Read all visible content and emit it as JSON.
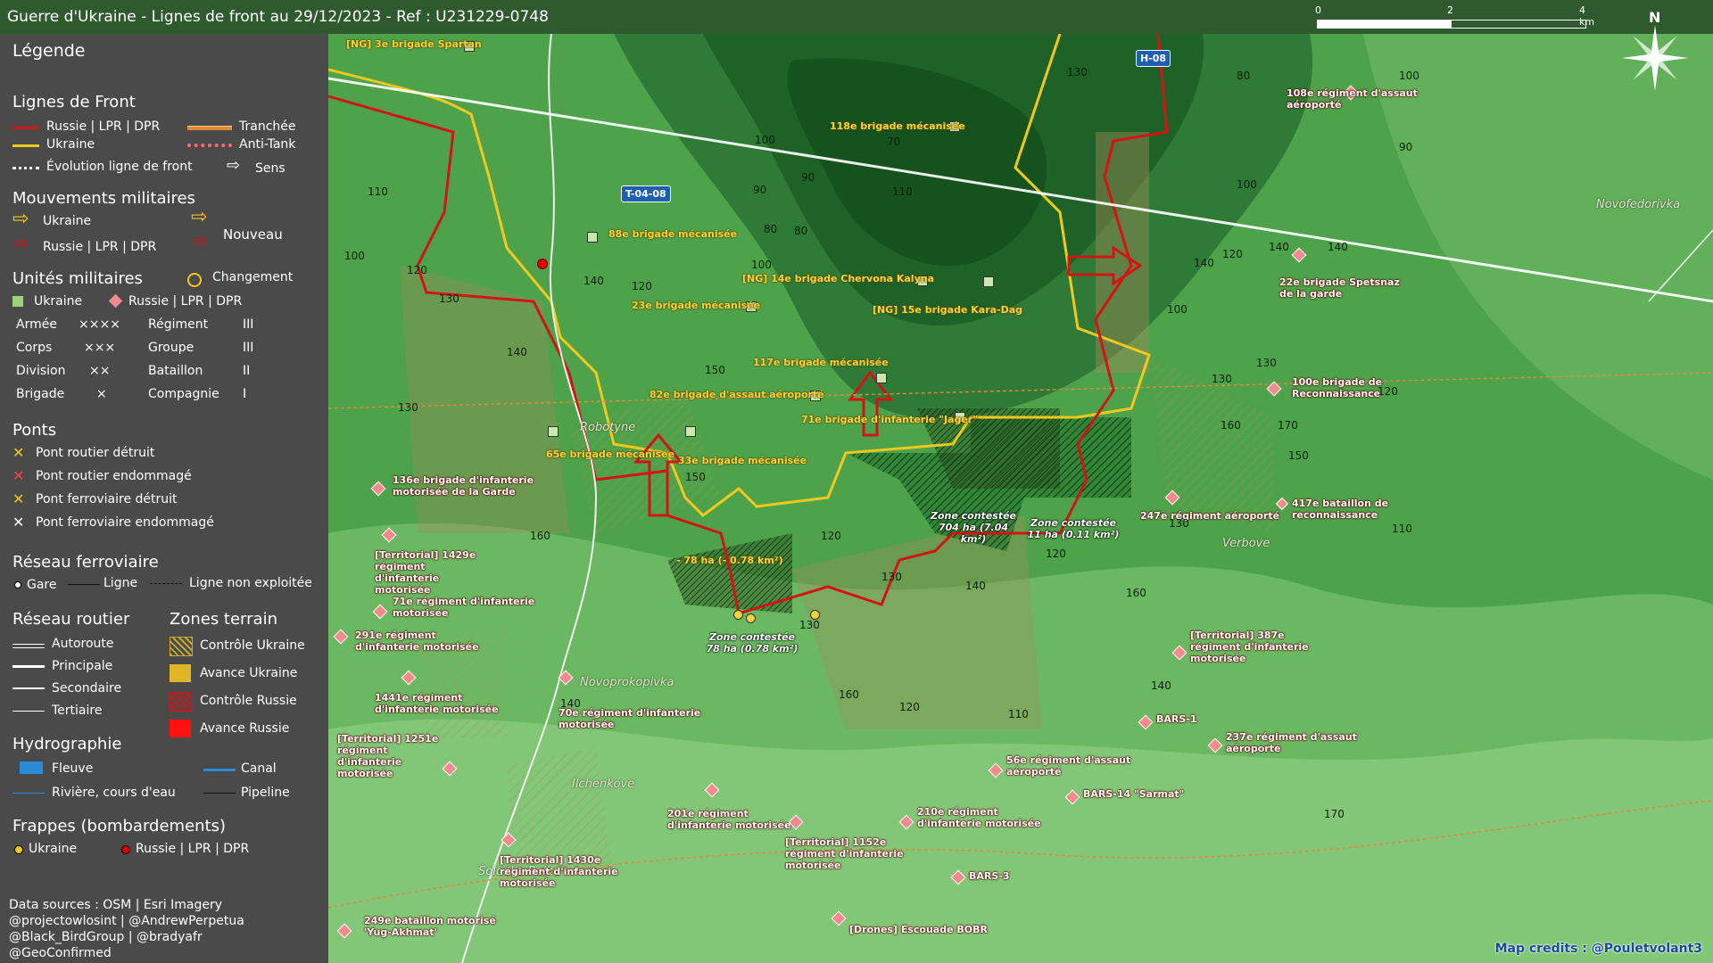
{
  "title": "Guerre d'Ukraine - Lignes de front au 29/12/2023 - Ref : U231229-0748",
  "scale": {
    "labels": [
      "0",
      "2",
      "4 km"
    ]
  },
  "north_label": "N",
  "legend": {
    "title": "Légende",
    "front_lines": {
      "heading": "Lignes de Front",
      "russia": "Russie | LPR | DPR",
      "ukraine": "Ukraine",
      "evolution": "Évolution ligne de front",
      "trench": "Tranchée",
      "antitank": "Anti-Tank",
      "direction": "Sens"
    },
    "movements": {
      "heading": "Mouvements militaires",
      "ukraine": "Ukraine",
      "russia": "Russie | LPR | DPR",
      "new": "Nouveau"
    },
    "units": {
      "heading": "Unités militaires",
      "change": "Changement",
      "ukraine": "Ukraine",
      "russia": "Russie | LPR | DPR",
      "rows": [
        {
          "left": "Armée",
          "left_sym": "××××",
          "right": "Régiment",
          "right_sym": "III"
        },
        {
          "left": "Corps",
          "left_sym": "×××",
          "right": "Groupe",
          "right_sym": "III"
        },
        {
          "left": "Division",
          "left_sym": "××",
          "right": "Bataillon",
          "right_sym": "II"
        },
        {
          "left": "Brigade",
          "left_sym": "×",
          "right": "Compagnie",
          "right_sym": "I"
        }
      ]
    },
    "bridges": {
      "heading": "Ponts",
      "items": [
        "Pont routier détruit",
        "Pont routier endommagé",
        "Pont ferroviaire détruit",
        "Pont ferroviaire endommagé"
      ]
    },
    "rail": {
      "heading": "Réseau ferroviaire",
      "station": "Gare",
      "line": "Ligne",
      "unused": "Ligne non exploitée"
    },
    "roads": {
      "heading": "Réseau routier",
      "items": [
        "Autoroute",
        "Principale",
        "Secondaire",
        "Tertiaire"
      ]
    },
    "terrain": {
      "heading": "Zones terrain",
      "items": [
        "Contrôle Ukraine",
        "Avance Ukraine",
        "Contrôle Russie",
        "Avance Russie"
      ]
    },
    "hydro": {
      "heading": "Hydrographie",
      "river": "Fleuve",
      "canal": "Canal",
      "stream": "Rivière, cours d'eau",
      "pipeline": "Pipeline"
    },
    "strikes": {
      "heading": "Frappes (bombardements)",
      "ukraine": "Ukraine",
      "russia": "Russie | LPR | DPR"
    },
    "credits": [
      "Data sources : OSM | Esri Imagery",
      "@projectowlosint | @AndrewPerpetua",
      "@Black_BirdGroup | @bradyafr",
      "@GeoConfirmed"
    ]
  },
  "colors": {
    "russia": "#d21414",
    "ukraine": "#f0c81e",
    "map_green": "#3f8c3f",
    "legend_bg": "#4a4a4a"
  },
  "map": {
    "road_tags": [
      "T-04-08",
      "H-08"
    ],
    "towns": [
      "Robotyne",
      "Novoprokopivka",
      "Ilchenkove",
      "Solodka Balka",
      "Verbove",
      "Novofedorivka"
    ],
    "ukraine_units": [
      "[NG] 3e brigade Spartan",
      "118e brigade mécanisée",
      "88e brigade mécanisée",
      "[NG] 14e brigade Chervona Kalyna",
      "23e brigade mécanisée",
      "[NG] 15e brigade Kara-Dag",
      "117e brigade mécanisée",
      "82e brigade d'assaut aéroporté",
      "71e brigade d'infanterie \"Jager\"",
      "65e brigade mécanisée",
      "33e brigade mécanisée"
    ],
    "russia_units": [
      "108e régiment d'assaut aéroporté",
      "22e brigade Spetsnaz de la garde",
      "100e brigade de Reconnaissance",
      "417e bataillon de reconnaissance",
      "247e régiment aéroporté",
      "136e brigade d'infanterie motorisée de la Garde",
      "[Territorial] 1429e régiment d'infanterie motorisée",
      "71e régiment d'infanterie motorisée",
      "291e régiment d'infanterie motorisée",
      "1441e régiment d'infanterie motorisée",
      "70e régiment d'infanterie motorisée",
      "[Territorial] 1251e régiment d'infanterie motorisée",
      "[Territorial] 1430e régiment d'infanterie motorisée",
      "201e régiment d'infanterie motorisée",
      "[Territorial] 1152e régiment d'infanterie motorisée",
      "210e régiment d'infanterie motorisée",
      "56e régiment d'assaut aéroporté",
      "BARS-14 \"Sarmat\"",
      "BARS-1",
      "237e régiment d'assaut aéroporté",
      "[Territorial] 387e régiment d'infanterie motorisée",
      "BARS-3",
      "[Drones] Escouade BOBR",
      "249e bataillon motorisé 'Yug-Akhmat'"
    ],
    "zones": [
      "Zone contestée 704 ha (7.04 km²)",
      "Zone contestée 11 ha (0.11 km²)",
      "Zone contestée 78 ha (0.78 km²)",
      "- 78 ha (- 0.78 km²)"
    ],
    "elevations": [
      "130",
      "100",
      "90",
      "110",
      "100",
      "120",
      "130",
      "140",
      "130",
      "140",
      "150",
      "150",
      "160",
      "120",
      "130",
      "140",
      "130",
      "140",
      "120",
      "110",
      "160",
      "140",
      "160",
      "170",
      "150",
      "140",
      "130",
      "120",
      "140",
      "130",
      "120",
      "100",
      "90",
      "80",
      "70",
      "90",
      "80",
      "120",
      "100",
      "80",
      "110",
      "100",
      "130",
      "140",
      "160",
      "170",
      "120",
      "110",
      "100"
    ],
    "credit": "Map credits : @Pouletvolant3"
  }
}
